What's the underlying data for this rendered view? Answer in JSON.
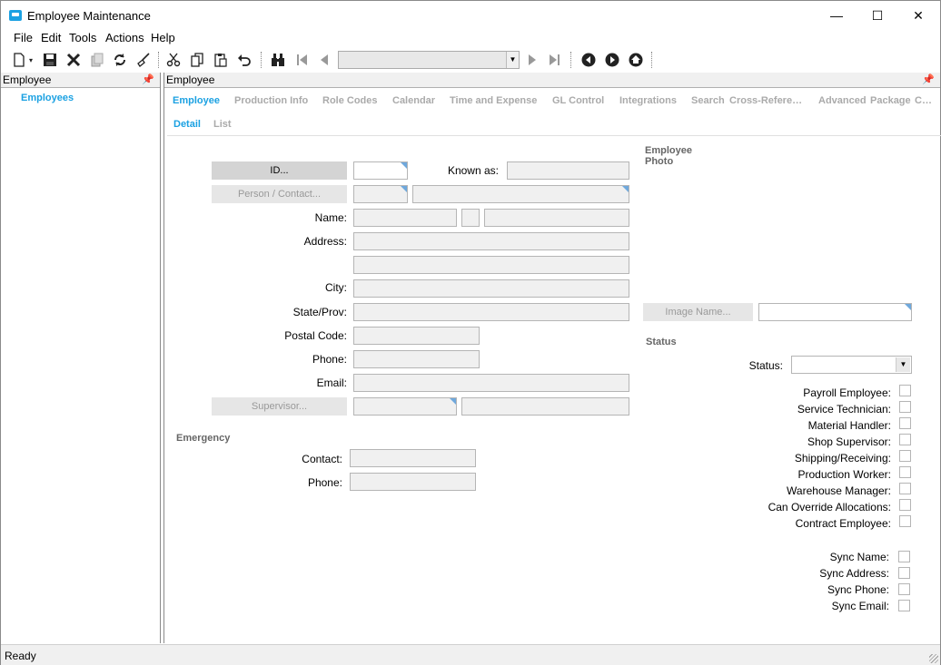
{
  "window": {
    "title": "Employee Maintenance",
    "minimize": "—",
    "maximize": "☐",
    "close": "✕"
  },
  "menu": [
    "File",
    "Edit",
    "Tools",
    "Actions",
    "Help"
  ],
  "left_pane": {
    "header": "Employee",
    "tree_item": "Employees"
  },
  "main_pane": {
    "header": "Employee"
  },
  "tabs": [
    "Employee",
    "Production Info",
    "Role Codes",
    "Calendar",
    "Time and Expense",
    "GL Control",
    "Integrations",
    "Search",
    "Cross-Refere…",
    "Advanced",
    "Package",
    "C…"
  ],
  "subtabs": [
    "Detail",
    "List"
  ],
  "form": {
    "id_button": "ID...",
    "known_as_label": "Known as:",
    "person_contact_button": "Person / Contact...",
    "name_label": "Name:",
    "address_label": "Address:",
    "city_label": "City:",
    "state_label": "State/Prov:",
    "postal_label": "Postal Code:",
    "phone_label": "Phone:",
    "email_label": "Email:",
    "supervisor_button": "Supervisor...",
    "emergency_section": "Emergency",
    "contact_label": "Contact:",
    "emergency_phone_label": "Phone:"
  },
  "photo": {
    "section": "Employee Photo",
    "image_name_button": "Image Name..."
  },
  "status": {
    "section": "Status",
    "status_label": "Status:",
    "roles": [
      "Payroll Employee:",
      "Service Technician:",
      "Material Handler:",
      "Shop Supervisor:",
      "Shipping/Receiving:",
      "Production Worker:",
      "Warehouse Manager:",
      "Can Override Allocations:",
      "Contract Employee:"
    ],
    "sync": [
      "Sync Name:",
      "Sync Address:",
      "Sync Phone:",
      "Sync Email:"
    ]
  },
  "statusbar": {
    "text": "Ready"
  },
  "icons": {
    "new": "new-document-icon",
    "save": "save-icon",
    "delete": "delete-icon",
    "copy_record": "copy-record-icon",
    "refresh": "refresh-icon",
    "clear": "clear-broom-icon",
    "cut": "cut-icon",
    "copy": "copy-icon",
    "paste": "paste-icon",
    "undo": "undo-icon",
    "find": "binoculars-icon",
    "first": "first-record-icon",
    "prev": "previous-record-icon",
    "next": "next-record-icon",
    "last": "last-record-icon",
    "back": "back-icon",
    "forward": "forward-icon",
    "home": "home-icon"
  },
  "colors": {
    "accent": "#1ba1e2"
  }
}
